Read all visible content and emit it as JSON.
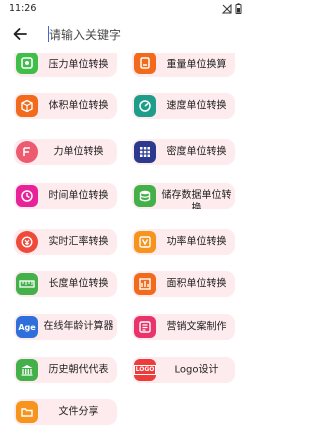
{
  "status_bar": {
    "time": "11:26"
  },
  "search": {
    "placeholder": "请输入关键字"
  },
  "tools": [
    {
      "label": "压力单位转换",
      "icon": "pressure-gauge-icon",
      "color": "#3fbf4a"
    },
    {
      "label": "重量单位换算",
      "icon": "weight-scale-icon",
      "color": "#f26a1b"
    },
    {
      "label": "体积单位转换",
      "icon": "volume-box-icon",
      "color": "#f26a1b"
    },
    {
      "label": "速度单位转换",
      "icon": "speedometer-icon",
      "color": "#1e9e8a"
    },
    {
      "label": "力单位转换",
      "icon": "force-icon",
      "color": "#ee5a6f"
    },
    {
      "label": "密度单位转换",
      "icon": "density-grid-icon",
      "color": "#2b3a8f"
    },
    {
      "label": "时间单位转换",
      "icon": "clock-icon",
      "color": "#e8239a"
    },
    {
      "label": "储存数据单位转换",
      "icon": "storage-database-icon",
      "color": "#43b04a"
    },
    {
      "label": "实时汇率转换",
      "icon": "currency-exchange-icon",
      "color": "#f04a3a"
    },
    {
      "label": "功率单位转换",
      "icon": "power-icon",
      "color": "#f7941d"
    },
    {
      "label": "长度单位转换",
      "icon": "ruler-icon",
      "color": "#43b04a"
    },
    {
      "label": "面积单位转换",
      "icon": "area-chart-icon",
      "color": "#f26a1b"
    },
    {
      "label": "在线年龄计算器",
      "icon": "age-icon",
      "icon_text": "Age",
      "color": "#2f6fdb"
    },
    {
      "label": "营销文案制作",
      "icon": "marketing-copy-icon",
      "color": "#e8336b"
    },
    {
      "label": "历史朝代代表",
      "icon": "history-temple-icon",
      "color": "#43b04a"
    },
    {
      "label": "Logo设计",
      "icon": "logo-design-icon",
      "icon_text": "LOGO",
      "color": "#ee3b3b"
    },
    {
      "label": "文件分享",
      "icon": "file-share-icon",
      "color": "#f7941d"
    }
  ]
}
